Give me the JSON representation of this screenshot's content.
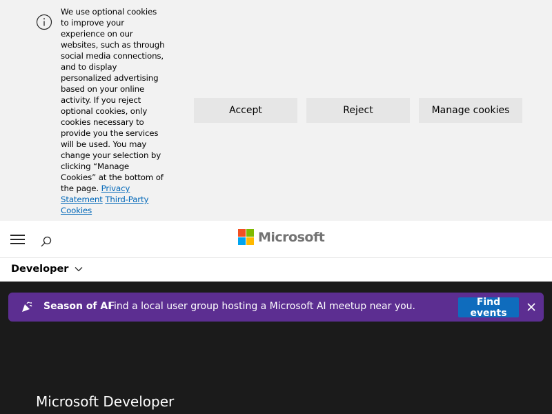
{
  "cookie_banner": {
    "message": "We use optional cookies to improve your experience on our websites, such as through social media connections, and to display personalized advertising based on your online activity. If you reject optional cookies, only cookies necessary to provide you the services will be used. You may change your selection by clicking “Manage Cookies” at the bottom of the page.",
    "privacy_link": "Privacy Statement",
    "third_party_link": "Third-Party Cookies",
    "accept_label": "Accept",
    "reject_label": "Reject",
    "manage_label": "Manage cookies",
    "icon": "info-icon"
  },
  "header": {
    "brand_name": "Microsoft",
    "logo_colors": [
      "#f25022",
      "#7fba00",
      "#00a4ef",
      "#ffb900"
    ],
    "menu_icon": "hamburger-menu-icon",
    "search_icon": "search-icon"
  },
  "subnav": {
    "label": "Developer",
    "icon": "chevron-down-icon"
  },
  "announcement": {
    "title": "Season of AI",
    "text": "Find a local user group hosting a Microsoft AI meetup near you.",
    "button_label": "Find events",
    "background_color": "#5c2e91",
    "button_color": "#0f6cbd",
    "icon": "celebration-icon",
    "close_icon": "close-icon"
  },
  "hero": {
    "title": "Microsoft Developer"
  },
  "colors": {
    "link": "#0067b8",
    "page_background": "#1b1b1b",
    "banner_background": "#f2f2f2"
  }
}
